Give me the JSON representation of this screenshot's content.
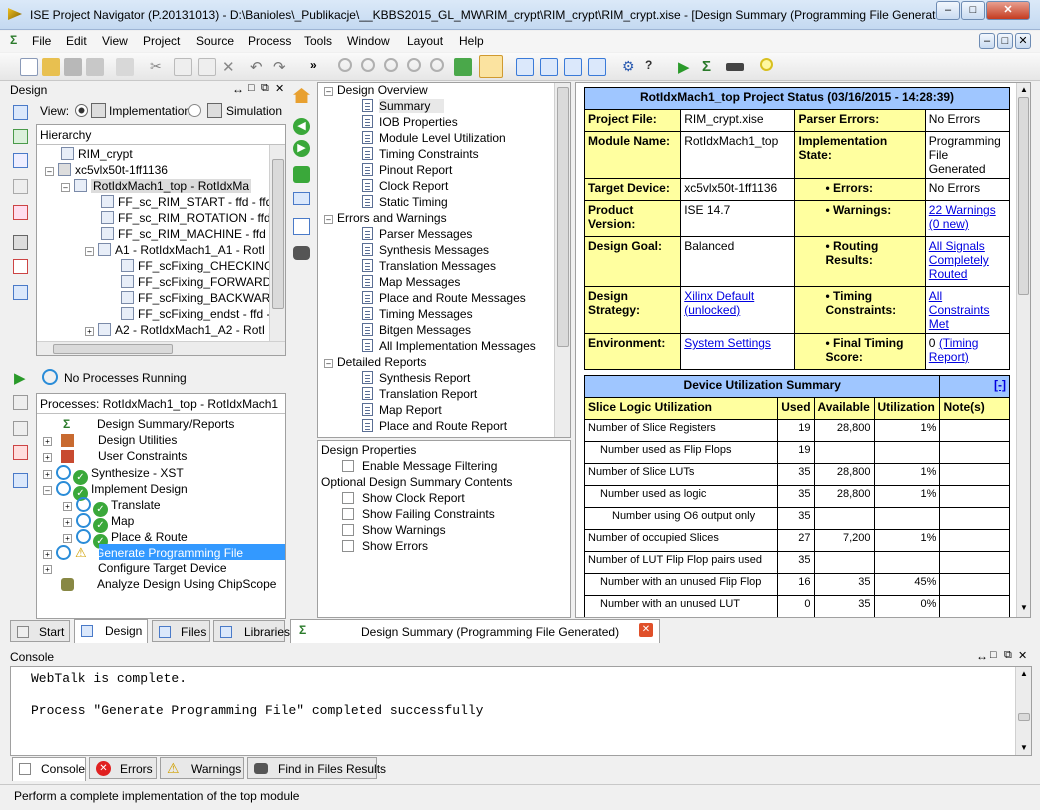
{
  "window": {
    "title": "ISE Project Navigator (P.20131013) - D:\\Banioles\\_Publikacje\\__KBBS2015_GL_MW\\RIM_crypt\\RIM_crypt\\RIM_crypt.xise - [Design Summary (Programming File Generate..."
  },
  "menu": [
    "File",
    "Edit",
    "View",
    "Project",
    "Source",
    "Process",
    "Tools",
    "Window",
    "Layout",
    "Help"
  ],
  "design_panel": {
    "title": "Design",
    "view_label": "View:",
    "impl_label": "Implementation",
    "sim_label": "Simulation",
    "hierarchy_label": "Hierarchy",
    "hierarchy": [
      "RIM_crypt",
      "xc5vlx50t-1ff1136",
      "RotIdxMach1_top - RotIdxMa",
      "FF_sc_RIM_START - ffd - ffd_",
      "FF_sc_RIM_ROTATION - ffd -",
      "FF_sc_RIM_MACHINE - ffd -",
      "A1 - RotIdxMach1_A1 - RotI",
      "FF_scFixing_CHECKING",
      "FF_scFixing_FORWARD -",
      "FF_scFixing_BACKWARD",
      "FF_scFixing_endst - ffd -",
      "A2 - RotIdxMach1_A2 - RotI"
    ],
    "no_processes": "No Processes Running",
    "processes_label": "Processes: RotIdxMach1_top - RotIdxMach1",
    "processes": [
      "Design Summary/Reports",
      "Design Utilities",
      "User Constraints",
      "Synthesize - XST",
      "Implement Design",
      "Translate",
      "Map",
      "Place & Route",
      "Generate Programming File",
      "Configure Target Device",
      "Analyze Design Using ChipScope"
    ]
  },
  "overview": {
    "groups": [
      {
        "label": "Design Overview",
        "items": [
          "Summary",
          "IOB Properties",
          "Module Level Utilization",
          "Timing Constraints",
          "Pinout Report",
          "Clock Report",
          "Static Timing"
        ]
      },
      {
        "label": "Errors and Warnings",
        "items": [
          "Parser Messages",
          "Synthesis Messages",
          "Translation Messages",
          "Map Messages",
          "Place and Route Messages",
          "Timing Messages",
          "Bitgen Messages",
          "All Implementation Messages"
        ]
      },
      {
        "label": "Detailed Reports",
        "items": [
          "Synthesis Report",
          "Translation Report",
          "Map Report",
          "Place and Route Report"
        ]
      }
    ],
    "design_properties": "Design Properties",
    "enable_filtering": "Enable Message Filtering",
    "optional_contents": "Optional Design Summary Contents",
    "options": [
      "Show Clock Report",
      "Show Failing Constraints",
      "Show Warnings",
      "Show Errors"
    ]
  },
  "status": {
    "title": "RotIdxMach1_top Project Status (03/16/2015 - 14:28:39)",
    "rows": [
      {
        "l1": "Project File:",
        "v1": "RIM_crypt.xise",
        "l2": "Parser Errors:",
        "v2": "No Errors"
      },
      {
        "l1": "Module Name:",
        "v1": "RotIdxMach1_top",
        "l2": "Implementation State:",
        "v2": "Programming File Generated"
      },
      {
        "l1": "Target Device:",
        "v1": "xc5vlx50t-1ff1136",
        "l2": "• Errors:",
        "v2": "No Errors"
      },
      {
        "l1": "Product Version:",
        "v1": "ISE 14.7",
        "l2": "• Warnings:",
        "v2": "22 Warnings (0 new)"
      },
      {
        "l1": "Design Goal:",
        "v1": "Balanced",
        "l2": "• Routing Results:",
        "v2": "All Signals Completely Routed"
      },
      {
        "l1": "Design Strategy:",
        "v1": "Xilinx Default (unlocked)",
        "l2": "• Timing Constraints:",
        "v2": "All Constraints Met"
      },
      {
        "l1": "Environment:",
        "v1": "System Settings",
        "l2": "• Final Timing Score:",
        "v2a": "0",
        "v2b": "(Timing Report)"
      }
    ]
  },
  "utilization": {
    "title": "Device Utilization Summary",
    "collapse": "[-]",
    "headers": [
      "Slice Logic Utilization",
      "Used",
      "Available",
      "Utilization",
      "Note(s)"
    ],
    "rows": [
      [
        "Number of Slice Registers",
        "19",
        "28,800",
        "1%",
        ""
      ],
      [
        "Number used as Flip Flops",
        "19",
        "",
        "",
        ""
      ],
      [
        "Number of Slice LUTs",
        "35",
        "28,800",
        "1%",
        ""
      ],
      [
        "Number used as logic",
        "35",
        "28,800",
        "1%",
        ""
      ],
      [
        "Number using O6 output only",
        "35",
        "",
        "",
        ""
      ],
      [
        "Number of occupied Slices",
        "27",
        "7,200",
        "1%",
        ""
      ],
      [
        "Number of LUT Flip Flop pairs used",
        "35",
        "",
        "",
        ""
      ],
      [
        "Number with an unused Flip Flop",
        "16",
        "35",
        "45%",
        ""
      ],
      [
        "Number with an unused LUT",
        "0",
        "35",
        "0%",
        ""
      ]
    ]
  },
  "left_tabs": [
    "Start",
    "Design",
    "Files",
    "Libraries"
  ],
  "doc_tab": "Design Summary (Programming File Generated)",
  "console": {
    "title": "Console",
    "lines": [
      "WebTalk is complete.",
      "",
      "Process \"Generate Programming File\" completed successfully"
    ],
    "tabs": [
      "Console",
      "Errors",
      "Warnings",
      "Find in Files Results"
    ]
  },
  "statusbar": "Perform a complete implementation of the top module"
}
